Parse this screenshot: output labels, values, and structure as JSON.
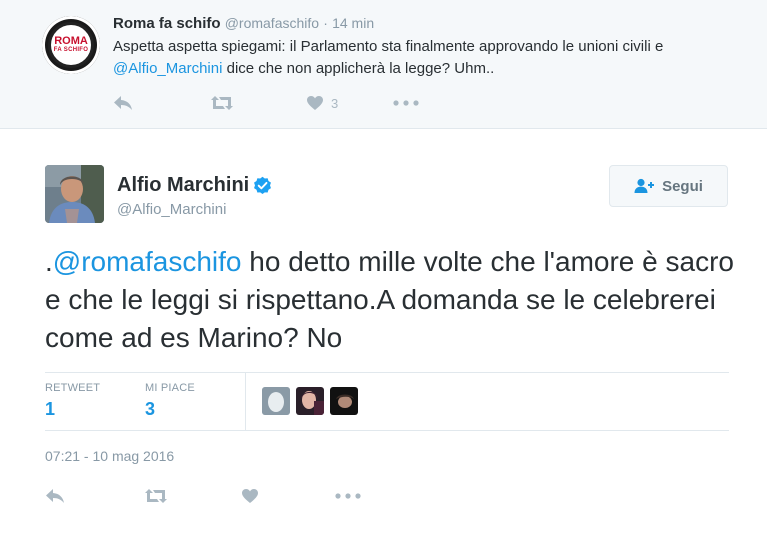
{
  "parent_tweet": {
    "avatar_logo_text": "ROMA FA SCHIFO",
    "name": "Roma fa schifo",
    "handle": "@romafaschifo",
    "separator": "·",
    "time": "14 min",
    "text_part1": "Aspetta aspetta spiegami: il Parlamento sta finalmente approvando le unioni civili e ",
    "mention": "@Alfio_Marchini",
    "text_part2": " dice che non applicherà la legge? Uhm..",
    "like_count": "3"
  },
  "main_tweet": {
    "name": "Alfio Marchini",
    "verified": true,
    "handle": "@Alfio_Marchini",
    "follow_label": "Segui",
    "text_prefix": ".",
    "mention": "@romafaschifo",
    "text_body": " ho detto mille volte che l'amore è sacro e che le leggi si rispettano.A domanda se le celebrerei come ad es Marino? No",
    "stats": {
      "retweet_label": "RETWEET",
      "retweet_count": "1",
      "likes_label": "MI PIACE",
      "likes_count": "3"
    },
    "date": "07:21 - 10 mag 2016"
  },
  "icons": [
    "reply-icon",
    "retweet-icon",
    "heart-icon",
    "more-icon",
    "verified-icon",
    "follow-user-icon"
  ],
  "colors": {
    "link": "#1b95e0",
    "icon_gray": "#aab8c2",
    "meta_gray": "#8899a6",
    "text": "#292f33",
    "parent_bg": "#f5f8fa"
  }
}
